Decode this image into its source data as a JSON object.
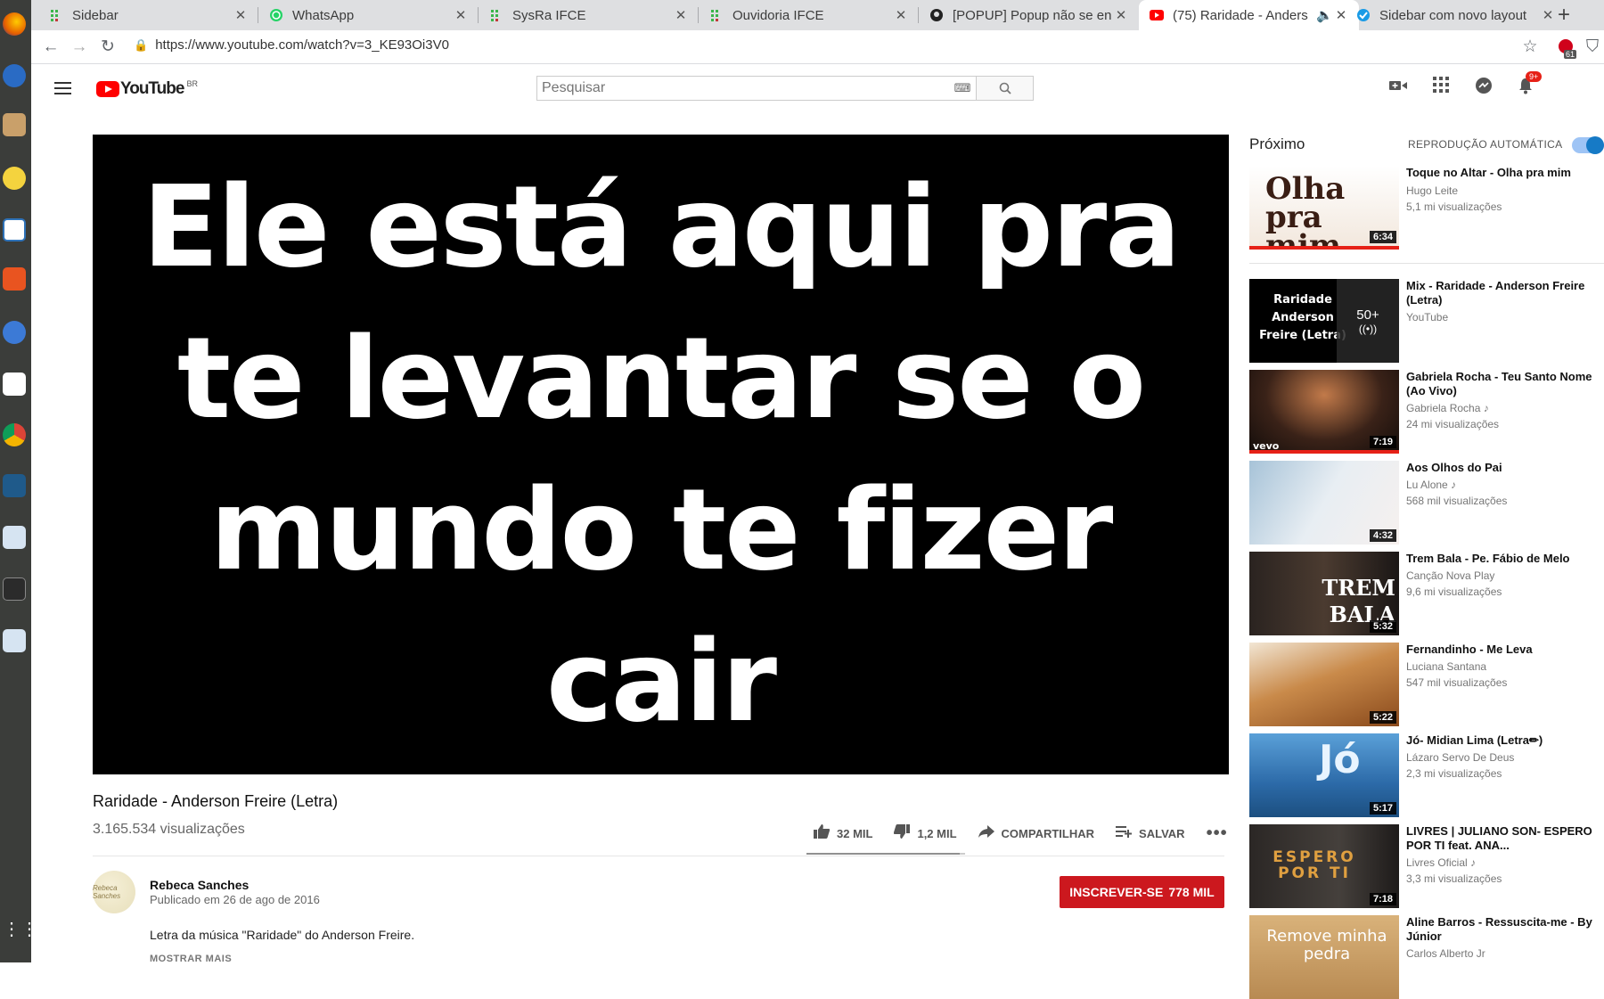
{
  "browser": {
    "tabs": [
      {
        "title": "Sidebar",
        "icon": "sysra-icon"
      },
      {
        "title": "WhatsApp",
        "icon": "whatsapp-icon"
      },
      {
        "title": "SysRa IFCE",
        "icon": "sysra-icon"
      },
      {
        "title": "Ouvidoria IFCE",
        "icon": "sysra-icon"
      },
      {
        "title": "[POPUP] Popup não se en",
        "icon": "github-icon"
      },
      {
        "title": "(75) Raridade - Anders",
        "icon": "youtube-icon"
      },
      {
        "title": "Sidebar com novo layout",
        "icon": "check-icon"
      }
    ],
    "new_tab": "+",
    "url": "https://www.youtube.com/watch?v=3_KE93Oi3V0",
    "ext_badge": "61"
  },
  "youtube": {
    "logo_text": "YouTube",
    "region": "BR",
    "search_placeholder": "Pesquisar",
    "notifications_badge": "9+"
  },
  "video": {
    "lyrics": "Ele está aqui pra te levantar se o mundo te fizer cair",
    "title": "Raridade - Anderson Freire (Letra)",
    "views": "3.165.534 visualizações",
    "likes": "32 MIL",
    "dislikes": "1,2 MIL",
    "share_label": "COMPARTILHAR",
    "save_label": "SALVAR",
    "like_ratio": 0.964,
    "channel": "Rebeca Sanches",
    "avatar_text": "Rebeca Sanches",
    "published": "Publicado em 26 de ago de 2016",
    "subscribe_label": "INSCREVER-SE",
    "subscribers": "778 MIL",
    "description": "Letra da música \"Raridade\" do Anderson Freire.",
    "show_more": "MOSTRAR MAIS"
  },
  "sidebar": {
    "next_label": "Próximo",
    "autoplay_label": "REPRODUÇÃO AUTOMÁTICA",
    "autoplay_on": true,
    "items": [
      {
        "title": "Toque no Altar - Olha pra mim",
        "channel": "Hugo Leite",
        "views": "5,1 mi visualizações",
        "duration": "6:34",
        "thumb_text": "Olha pra mim"
      },
      {
        "title": "Mix - Raridade - Anderson Freire (Letra)",
        "channel": "YouTube",
        "views": "",
        "duration": "",
        "thumb_text": "Raridade Anderson Freire (Letra)",
        "mix_count": "50+"
      },
      {
        "title": "Gabriela Rocha - Teu Santo Nome (Ao Vivo)",
        "channel": "Gabriela Rocha ♪",
        "views": "24 mi visualizações",
        "duration": "7:19",
        "thumb_text": "vevo"
      },
      {
        "title": "Aos Olhos do Pai",
        "channel": "Lu Alone ♪",
        "views": "568 mil visualizações",
        "duration": "4:32",
        "thumb_text": ""
      },
      {
        "title": "Trem Bala - Pe. Fábio de Melo",
        "channel": "Canção Nova Play",
        "views": "9,6 mi visualizações",
        "duration": "5:32",
        "thumb_text": "TREM BALA"
      },
      {
        "title": "Fernandinho - Me Leva",
        "channel": "Luciana Santana",
        "views": "547 mil visualizações",
        "duration": "5:22",
        "thumb_text": ""
      },
      {
        "title": "Jó- Midian Lima (Letra✏)",
        "channel": "Lázaro Servo De Deus",
        "views": "2,3 mi visualizações",
        "duration": "5:17",
        "thumb_text": "Jó"
      },
      {
        "title": "LIVRES | JULIANO SON- ESPERO POR TI feat. ANA...",
        "channel": "Livres Oficial ♪",
        "views": "3,3 mi visualizações",
        "duration": "7:18",
        "thumb_text": "ESPERO POR TI"
      },
      {
        "title": "Aline Barros - Ressuscita-me - By Júnior",
        "channel": "Carlos Alberto Jr",
        "views": "",
        "duration": "",
        "thumb_text": "Remove minha pedra"
      }
    ]
  }
}
